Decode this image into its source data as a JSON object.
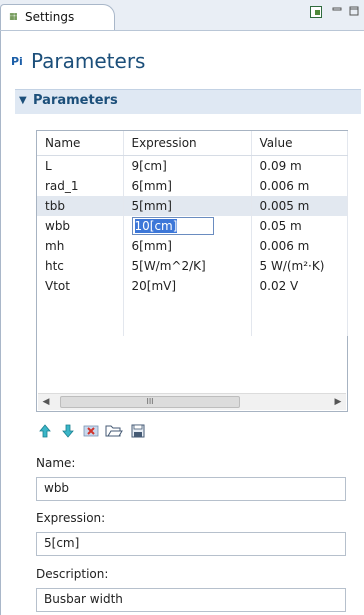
{
  "window": {
    "tab_title": "Settings",
    "tab_icon": "settings-grid-icon",
    "buttons": [
      "dock-icon",
      "minimize-icon",
      "maximize-icon"
    ]
  },
  "node": {
    "icon_text": "Pi",
    "title": "Parameters"
  },
  "section": {
    "title": "Parameters"
  },
  "table": {
    "headers": [
      "Name",
      "Expression",
      "Value"
    ],
    "rows": [
      {
        "name": "L",
        "expression": "9[cm]",
        "value": "0.09 m"
      },
      {
        "name": "rad_1",
        "expression": "6[mm]",
        "value": "0.006 m"
      },
      {
        "name": "tbb",
        "expression": "5[mm]",
        "value": "0.005 m"
      },
      {
        "name": "wbb",
        "expression": "10[cm]",
        "value": "0.05 m"
      },
      {
        "name": "mh",
        "expression": "6[mm]",
        "value": "0.006 m"
      },
      {
        "name": "htc",
        "expression": "5[W/m^2/K]",
        "value": "5 W/(m²·K)"
      },
      {
        "name": "Vtot",
        "expression": "20[mV]",
        "value": "0.02 V"
      }
    ],
    "selected_row": "tbb",
    "editing_row": "wbb",
    "scroll_thumb_text": "III"
  },
  "toolbar": [
    "move-up-icon",
    "move-down-icon",
    "delete-icon",
    "load-from-file-icon",
    "save-to-file-icon"
  ],
  "form": {
    "name_label": "Name:",
    "name_value": "wbb",
    "expression_label": "Expression:",
    "expression_value": "5[cm]",
    "description_label": "Description:",
    "description_value": "Busbar width"
  },
  "colors": {
    "accent": "#1c4f7a",
    "selection": "#e2e8f0",
    "edit_highlight": "#3d77d8"
  }
}
